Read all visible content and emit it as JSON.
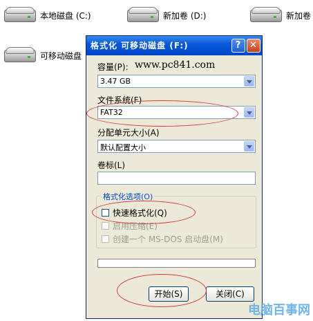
{
  "desktop": {
    "drives": [
      {
        "label": "本地磁盘 (C:)"
      },
      {
        "label": "新加卷 (D:)"
      },
      {
        "label": "新加卷"
      },
      {
        "label": "可移动磁盘"
      }
    ]
  },
  "dialog": {
    "title": "格式化 可移动磁盘 (F:)",
    "help_label": "?",
    "close_label": "✕",
    "capacity_label": "容量(P):",
    "capacity_value": "3.47 GB",
    "site_url": "www.pc841.com",
    "filesystem_label": "文件系统(F)",
    "filesystem_value": "FAT32",
    "alloc_label": "分配单元大小(A)",
    "alloc_value": "默认配置大小",
    "volume_label": "卷标(L)",
    "volume_value": "",
    "options_title": "格式化选项(O)",
    "options": {
      "quick": "快速格式化(Q)",
      "compress": "启用压缩(E)",
      "msdos": "创建一个 MS-DOS 启动盘(M)"
    },
    "progress": 0,
    "start_label": "开始(S)",
    "close_button_label": "关闭(C)"
  },
  "watermark": "电脑百事网"
}
